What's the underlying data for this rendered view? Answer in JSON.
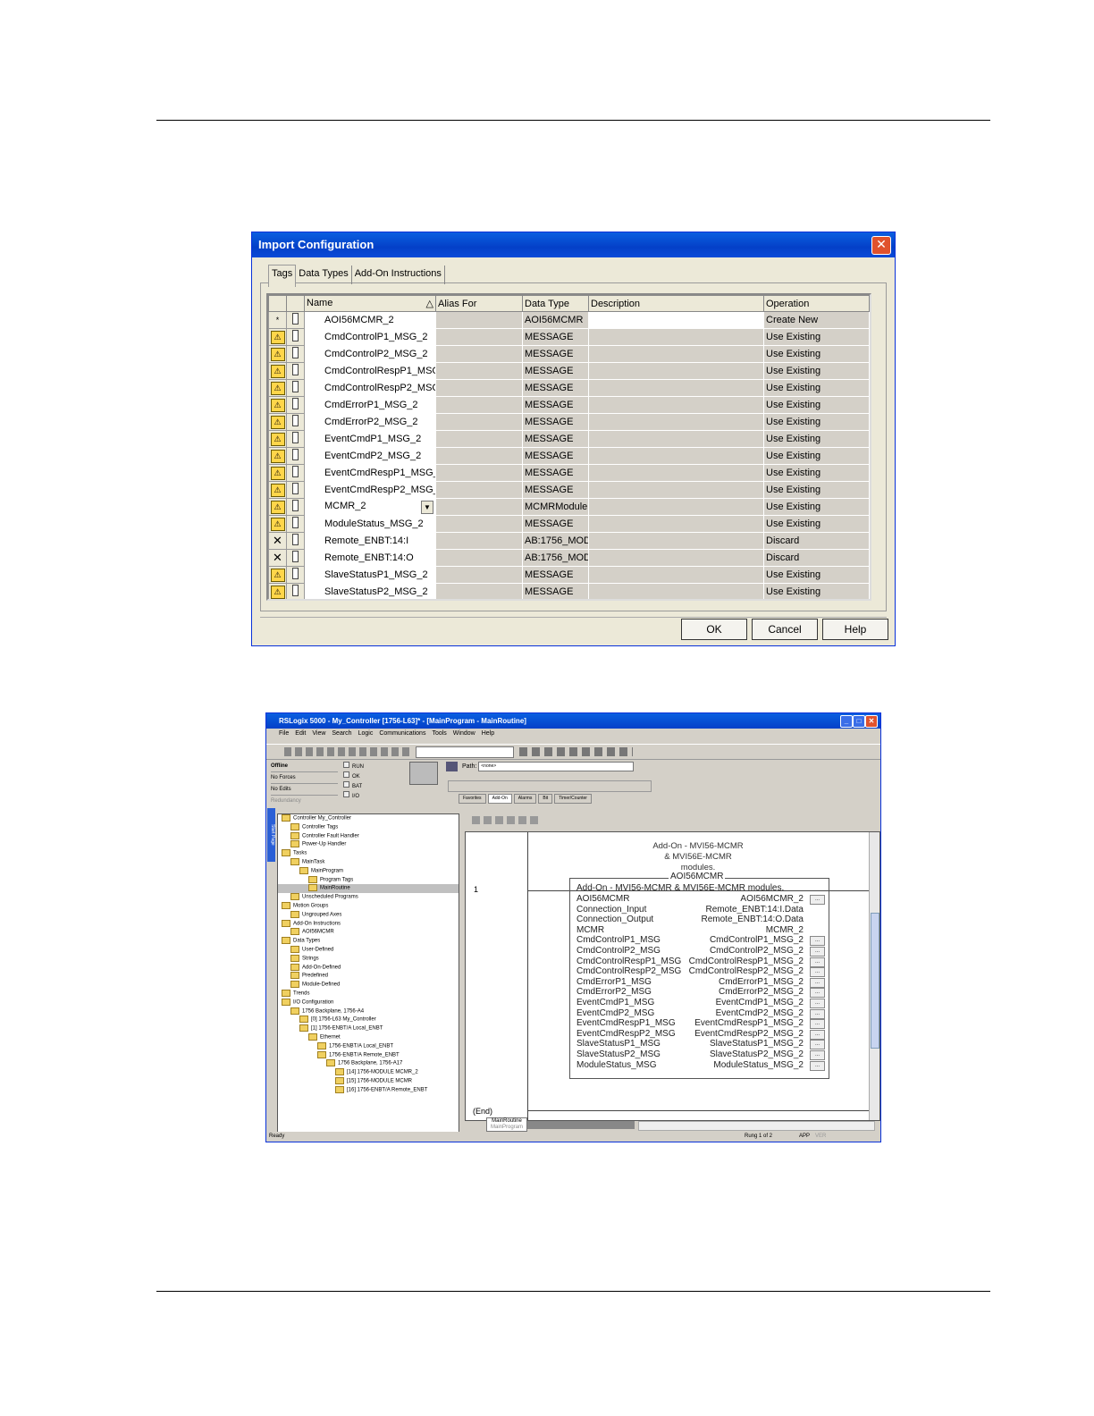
{
  "dialog": {
    "title": "Import Configuration",
    "close": "✕",
    "tabs": [
      "Tags",
      "Data Types",
      "Add-On Instructions"
    ],
    "columns": [
      "Name",
      "Alias For",
      "Data Type",
      "Description",
      "Operation"
    ],
    "sort_glyph": "△",
    "rows": [
      {
        "status": "new",
        "name": "AOI56MCMR_2",
        "alias": "",
        "type": "AOI56MCMR",
        "op": "Create New"
      },
      {
        "status": "warn",
        "name": "CmdControlP1_MSG_2",
        "alias": "",
        "type": "MESSAGE",
        "op": "Use Existing"
      },
      {
        "status": "warn",
        "name": "CmdControlP2_MSG_2",
        "alias": "",
        "type": "MESSAGE",
        "op": "Use Existing"
      },
      {
        "status": "warn",
        "name": "CmdControlRespP1_MSG_2",
        "alias": "",
        "type": "MESSAGE",
        "op": "Use Existing"
      },
      {
        "status": "warn",
        "name": "CmdControlRespP2_MSG_2",
        "alias": "",
        "type": "MESSAGE",
        "op": "Use Existing"
      },
      {
        "status": "warn",
        "name": "CmdErrorP1_MSG_2",
        "alias": "",
        "type": "MESSAGE",
        "op": "Use Existing"
      },
      {
        "status": "warn",
        "name": "CmdErrorP2_MSG_2",
        "alias": "",
        "type": "MESSAGE",
        "op": "Use Existing"
      },
      {
        "status": "warn",
        "name": "EventCmdP1_MSG_2",
        "alias": "",
        "type": "MESSAGE",
        "op": "Use Existing"
      },
      {
        "status": "warn",
        "name": "EventCmdP2_MSG_2",
        "alias": "",
        "type": "MESSAGE",
        "op": "Use Existing"
      },
      {
        "status": "warn",
        "name": "EventCmdRespP1_MSG_2",
        "alias": "",
        "type": "MESSAGE",
        "op": "Use Existing"
      },
      {
        "status": "warn",
        "name": "EventCmdRespP2_MSG_2",
        "alias": "",
        "type": "MESSAGE",
        "op": "Use Existing"
      },
      {
        "status": "warn",
        "name": "MCMR_2",
        "alias": "",
        "type": "MCMRModule",
        "op": "Use Existing",
        "dropdown": true
      },
      {
        "status": "warn",
        "name": "ModuleStatus_MSG_2",
        "alias": "",
        "type": "MESSAGE",
        "op": "Use Existing"
      },
      {
        "status": "discard",
        "name": "Remote_ENBT:14:I",
        "alias": "",
        "type": "AB:1756_MOD",
        "op": "Discard"
      },
      {
        "status": "discard",
        "name": "Remote_ENBT:14:O",
        "alias": "",
        "type": "AB:1756_MOD",
        "op": "Discard"
      },
      {
        "status": "warn",
        "name": "SlaveStatusP1_MSG_2",
        "alias": "",
        "type": "MESSAGE",
        "op": "Use Existing"
      },
      {
        "status": "warn",
        "name": "SlaveStatusP2_MSG_2",
        "alias": "",
        "type": "MESSAGE",
        "op": "Use Existing"
      }
    ],
    "buttons": {
      "ok": "OK",
      "cancel": "Cancel",
      "help": "Help"
    }
  },
  "rslogix": {
    "title": "RSLogix 5000 - My_Controller [1756-L63]* - [MainProgram - MainRoutine]",
    "menu": [
      "File",
      "Edit",
      "View",
      "Search",
      "Logic",
      "Communications",
      "Tools",
      "Window",
      "Help"
    ],
    "status_panel": {
      "mode": "Offline",
      "forces": "No Forces",
      "edits": "No Edits",
      "redundancy": "Redundancy"
    },
    "leds": [
      "RUN",
      "OK",
      "BAT",
      "I/O"
    ],
    "path_label": "Path:",
    "path_value": "<none>",
    "palette_tabs": [
      "Favorites",
      "Add-On",
      "Alarms",
      "Bit",
      "Timer/Counter"
    ],
    "side_tab": "Start Page",
    "tree": [
      {
        "d": 0,
        "t": "Controller My_Controller"
      },
      {
        "d": 1,
        "t": "Controller Tags"
      },
      {
        "d": 1,
        "t": "Controller Fault Handler"
      },
      {
        "d": 1,
        "t": "Power-Up Handler"
      },
      {
        "d": 0,
        "t": "Tasks"
      },
      {
        "d": 1,
        "t": "MainTask"
      },
      {
        "d": 2,
        "t": "MainProgram"
      },
      {
        "d": 3,
        "t": "Program Tags"
      },
      {
        "d": 3,
        "t": "MainRoutine"
      },
      {
        "d": 1,
        "t": "Unscheduled Programs"
      },
      {
        "d": 0,
        "t": "Motion Groups"
      },
      {
        "d": 1,
        "t": "Ungrouped Axes"
      },
      {
        "d": 0,
        "t": "Add-On Instructions"
      },
      {
        "d": 1,
        "t": "AOI56MCMR"
      },
      {
        "d": 0,
        "t": "Data Types"
      },
      {
        "d": 1,
        "t": "User-Defined"
      },
      {
        "d": 1,
        "t": "Strings"
      },
      {
        "d": 1,
        "t": "Add-On-Defined"
      },
      {
        "d": 1,
        "t": "Predefined"
      },
      {
        "d": 1,
        "t": "Module-Defined"
      },
      {
        "d": 0,
        "t": "Trends"
      },
      {
        "d": 0,
        "t": "I/O Configuration"
      },
      {
        "d": 1,
        "t": "1756 Backplane, 1756-A4"
      },
      {
        "d": 2,
        "t": "[0] 1756-L63 My_Controller"
      },
      {
        "d": 2,
        "t": "[1] 1756-ENBT/A Local_ENBT"
      },
      {
        "d": 3,
        "t": "Ethernet"
      },
      {
        "d": 4,
        "t": "1756-ENBT/A Local_ENBT"
      },
      {
        "d": 4,
        "t": "1756-ENBT/A Remote_ENBT"
      },
      {
        "d": 5,
        "t": "1756 Backplane, 1756-A17"
      },
      {
        "d": 6,
        "t": "[14] 1756-MODULE MCMR_2"
      },
      {
        "d": 6,
        "t": "[15] 1756-MODULE MCMR"
      },
      {
        "d": 6,
        "t": "[16] 1756-ENBT/A Remote_ENBT"
      }
    ],
    "rung_comment": [
      "Add-On - MVI56-MCMR",
      "& MVI56E-MCMR",
      "modules."
    ],
    "rung_number": "1",
    "end_label": "(End)",
    "aoi_tag": "AOI56MCMR",
    "aoi_title": "Add-On - MVI56-MCMR & MVI56E-MCMR modules.",
    "aoi_params": [
      {
        "p": "AOI56MCMR",
        "v": "AOI56MCMR_2",
        "btn": true
      },
      {
        "p": "Connection_Input",
        "v": "Remote_ENBT:14:I.Data",
        "btn": false
      },
      {
        "p": "Connection_Output",
        "v": "Remote_ENBT:14:O.Data",
        "btn": false
      },
      {
        "p": "MCMR",
        "v": "MCMR_2",
        "btn": false
      },
      {
        "p": "CmdControlP1_MSG",
        "v": "CmdControlP1_MSG_2",
        "btn": true
      },
      {
        "p": "CmdControlP2_MSG",
        "v": "CmdControlP2_MSG_2",
        "btn": true
      },
      {
        "p": "CmdControlRespP1_MSG",
        "v": "CmdControlRespP1_MSG_2",
        "btn": true
      },
      {
        "p": "CmdControlRespP2_MSG",
        "v": "CmdControlRespP2_MSG_2",
        "btn": true
      },
      {
        "p": "CmdErrorP1_MSG",
        "v": "CmdErrorP1_MSG_2",
        "btn": true
      },
      {
        "p": "CmdErrorP2_MSG",
        "v": "CmdErrorP2_MSG_2",
        "btn": true
      },
      {
        "p": "EventCmdP1_MSG",
        "v": "EventCmdP1_MSG_2",
        "btn": true
      },
      {
        "p": "EventCmdP2_MSG",
        "v": "EventCmdP2_MSG_2",
        "btn": true
      },
      {
        "p": "EventCmdRespP1_MSG",
        "v": "EventCmdRespP1_MSG_2",
        "btn": true
      },
      {
        "p": "EventCmdRespP2_MSG",
        "v": "EventCmdRespP2_MSG_2",
        "btn": true
      },
      {
        "p": "SlaveStatusP1_MSG",
        "v": "SlaveStatusP1_MSG_2",
        "btn": true
      },
      {
        "p": "SlaveStatusP2_MSG",
        "v": "SlaveStatusP2_MSG_2",
        "btn": true
      },
      {
        "p": "ModuleStatus_MSG",
        "v": "ModuleStatus_MSG_2",
        "btn": true
      }
    ],
    "routine_tab": "MainRoutine",
    "routine_sub": "MainProgram",
    "status_bar": {
      "left": "Ready",
      "rung": "Rung 1 of 2",
      "app": "APP",
      "ver": "VER"
    }
  }
}
